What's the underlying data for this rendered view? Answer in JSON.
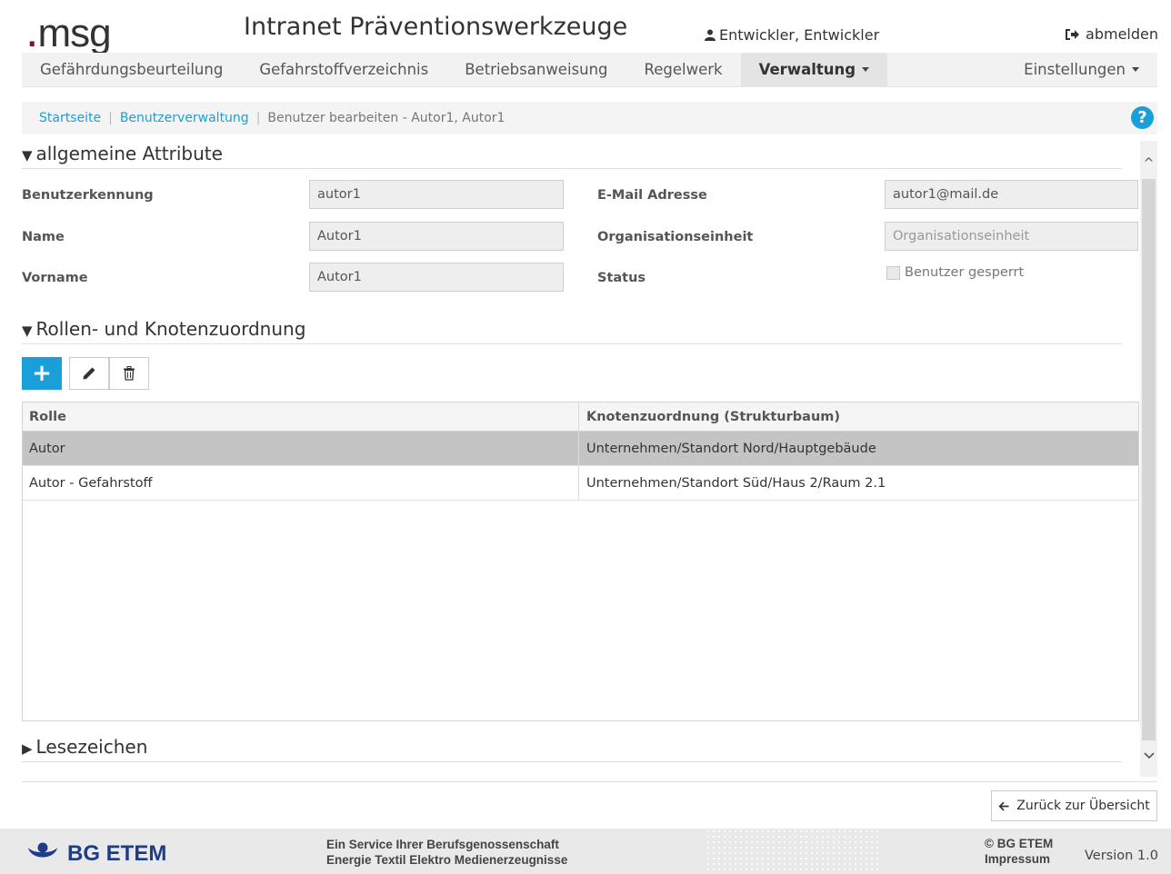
{
  "header": {
    "logo_text": "msg",
    "title": "Intranet Präventionswerkzeuge",
    "user": "Entwickler, Entwickler",
    "logout_label": "abmelden"
  },
  "nav": {
    "items": [
      {
        "label": "Gefährdungsbeurteilung",
        "active": false
      },
      {
        "label": "Gefahrstoffverzeichnis",
        "active": false
      },
      {
        "label": "Betriebsanweisung",
        "active": false
      },
      {
        "label": "Regelwerk",
        "active": false
      },
      {
        "label": "Verwaltung",
        "active": true
      }
    ],
    "settings_label": "Einstellungen"
  },
  "breadcrumb": {
    "home": "Startseite",
    "users": "Benutzerverwaltung",
    "current": "Benutzer bearbeiten - Autor1, Autor1",
    "help": "?"
  },
  "general": {
    "title": "allgemeine Attribute",
    "fields": {
      "login_label": "Benutzerkennung",
      "login_value": "autor1",
      "name_label": "Name",
      "name_value": "Autor1",
      "firstname_label": "Vorname",
      "firstname_value": "Autor1",
      "email_label": "E-Mail Adresse",
      "email_value": "autor1@mail.de",
      "org_label": "Organisationseinheit",
      "org_placeholder": "Organisationseinheit",
      "status_label": "Status",
      "locked_label": "Benutzer gesperrt"
    }
  },
  "roles": {
    "title": "Rollen- und Knotenzuordnung",
    "columns": [
      "Rolle",
      "Knotenzuordnung (Strukturbaum)"
    ],
    "rows": [
      {
        "role": "Autor",
        "node": "Unternehmen/Standort Nord/Hauptgebäude",
        "selected": true
      },
      {
        "role": "Autor - Gefahrstoff",
        "node": "Unternehmen/Standort Süd/Haus 2/Raum 2.1",
        "selected": false
      }
    ]
  },
  "bookmarks": {
    "title": "Lesezeichen"
  },
  "back_label": "Zurück zur Übersicht",
  "footer": {
    "brand": "BG ETEM",
    "service_line1": "Ein Service Ihrer Berufsgenossenschaft",
    "service_line2": "Energie Textil Elektro Medienerzeugnisse",
    "copyright": "© BG ETEM",
    "impressum": "Impressum",
    "version": "Version 1.0"
  },
  "colors": {
    "accent": "#1b9fd8",
    "brand_dot": "#8b0a2e",
    "footer_brand": "#1e3c87"
  }
}
